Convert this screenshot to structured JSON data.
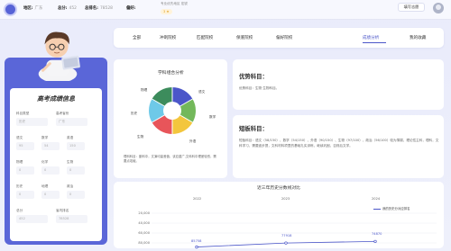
{
  "header": {
    "region_label": "地区:",
    "region_value": "广东",
    "score_label": "总分:",
    "score_value": "452",
    "rank_label": "总排名:",
    "rank_value": "78528",
    "pref_label": "偏好:",
    "pref_value": "专业优先地区",
    "pref_sub": "宏锐",
    "stars": "3 ★",
    "fill_button": "填写志愿"
  },
  "tabs": [
    {
      "label": "全部",
      "active": false
    },
    {
      "label": "冲刺院校",
      "active": false
    },
    {
      "label": "匹配院校",
      "active": false
    },
    {
      "label": "保底院校",
      "active": false
    },
    {
      "label": "偏好院校",
      "active": false
    },
    {
      "label": "成绩分析",
      "active": true
    },
    {
      "label": "我的收藏",
      "active": false
    }
  ],
  "info": {
    "title": "高考成绩信息",
    "fields": [
      {
        "label": "科目类型",
        "value": "历史"
      },
      {
        "label": "高考省份",
        "value": "广东"
      },
      {
        "label": "语文",
        "value": "95"
      },
      {
        "label": "数学",
        "value": "54"
      },
      {
        "label": "英语",
        "value": "150"
      },
      {
        "label": "物理",
        "value": "0"
      },
      {
        "label": "化学",
        "value": "0"
      },
      {
        "label": "生物",
        "value": "0"
      },
      {
        "label": "历史",
        "value": "0"
      },
      {
        "label": "地理",
        "value": "0"
      },
      {
        "label": "政治",
        "value": "0"
      },
      {
        "label": "总分",
        "value": "452"
      },
      {
        "label": "省内排名",
        "value": "78528"
      }
    ]
  },
  "subject_chart": {
    "title": "学科组合分析",
    "labels": [
      "物理",
      "语文",
      "数学",
      "外语",
      "生物",
      "历史"
    ],
    "note": "理科科目：副科中，文演均量差值，该应重广,文科科中理差较低，需要点攻破。"
  },
  "strength": {
    "title": "优势科目：",
    "text": "优势科目：生物 生物科目。"
  },
  "weakness": {
    "title": "短板科目：",
    "text": "短板科目：语文（58/150）、数学（54/150）、外语（90/150）、生物（97/100）、政治（56/100）较为薄弱，理论性主科，理科，文科学习，需要逐步提，文科材料项里的基础扎实训练，继续巩固，否则后文学。"
  },
  "line_chart_title": "近三年历史分数线对比",
  "chart_data": {
    "type": "line",
    "title": "近三年历史分数线对比",
    "categories": [
      "2022",
      "2023",
      "2024"
    ],
    "series": [
      {
        "name": "我的历史分对应排名",
        "values": [
          85758,
          77918,
          74870
        ]
      }
    ],
    "yticks": [
      "20,000",
      "40,000",
      "60,000",
      "80,000"
    ],
    "data_labels": [
      "85758",
      "77918",
      "74870"
    ],
    "legend_position": "right",
    "line_color": "#4b56c9"
  },
  "colors": {
    "accent": "#4b56c9",
    "panel": "#5a66d8",
    "pie": [
      "#4b56c9",
      "#73b85b",
      "#f3c63d",
      "#e8555a",
      "#6ec9e8",
      "#3c8c5c"
    ]
  }
}
